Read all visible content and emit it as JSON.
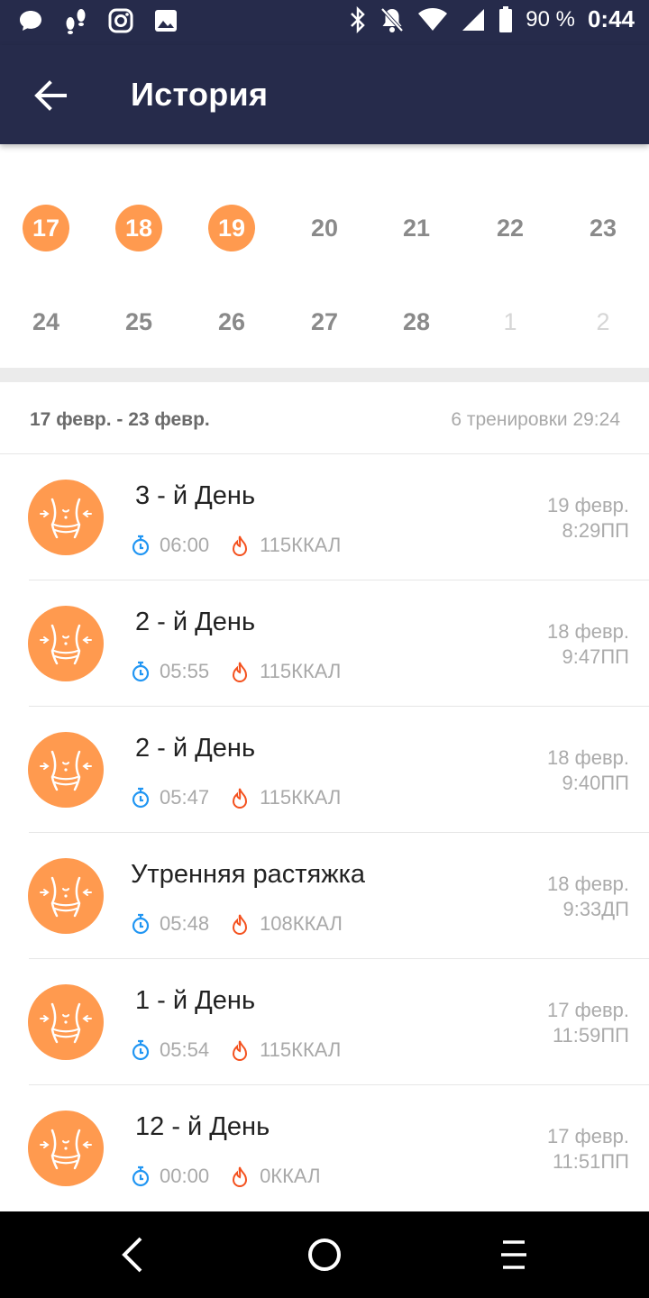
{
  "status_bar": {
    "battery": "90 %",
    "time": "0:44",
    "left_icons": [
      "chat-icon",
      "steps-icon",
      "instagram-icon",
      "image-icon"
    ],
    "right_icons": [
      "bluetooth-icon",
      "notifications-off-icon",
      "wifi-icon",
      "signal-icon",
      "battery-icon"
    ]
  },
  "app_bar": {
    "title": "История",
    "back_icon": "arrow-left-icon"
  },
  "calendar": {
    "rows": [
      {
        "days": [
          {
            "label": "17",
            "state": "done"
          },
          {
            "label": "18",
            "state": "done"
          },
          {
            "label": "19",
            "state": "done"
          },
          {
            "label": "20",
            "state": "normal"
          },
          {
            "label": "21",
            "state": "normal"
          },
          {
            "label": "22",
            "state": "normal"
          },
          {
            "label": "23",
            "state": "normal"
          }
        ]
      },
      {
        "days": [
          {
            "label": "24",
            "state": "normal"
          },
          {
            "label": "25",
            "state": "normal"
          },
          {
            "label": "26",
            "state": "normal"
          },
          {
            "label": "27",
            "state": "normal"
          },
          {
            "label": "28",
            "state": "normal"
          },
          {
            "label": "1",
            "state": "faded"
          },
          {
            "label": "2",
            "state": "faded"
          }
        ]
      }
    ]
  },
  "week": {
    "range": "17 февр. - 23 февр.",
    "summary": "6 тренировки 29:24"
  },
  "workouts": [
    {
      "title": "3 - й День",
      "duration": "06:00",
      "calories": "115ККАЛ",
      "date": "19 февр.",
      "time": "8:29ПП"
    },
    {
      "title": "2 - й День",
      "duration": "05:55",
      "calories": "115ККАЛ",
      "date": "18 февр.",
      "time": "9:47ПП"
    },
    {
      "title": "2 - й День",
      "duration": "05:47",
      "calories": "115ККАЛ",
      "date": "18 февр.",
      "time": "9:40ПП"
    },
    {
      "title": "Утренняя растяжка",
      "duration": "05:48",
      "calories": "108ККАЛ",
      "date": "18 февр.",
      "time": "9:33ДП"
    },
    {
      "title": "1 - й День",
      "duration": "05:54",
      "calories": "115ККАЛ",
      "date": "17 февр.",
      "time": "11:59ПП"
    },
    {
      "title": "12 - й День",
      "duration": "00:00",
      "calories": "0ККАЛ",
      "date": "17 февр.",
      "time": "11:51ПП"
    }
  ],
  "colors": {
    "header": "#262b4b",
    "accent": "#ff9a4f",
    "timer": "#2196f3",
    "fire": "#f4511e"
  },
  "nav_bar": {
    "icons": [
      "back-triangle-icon",
      "home-circle-icon",
      "menu-icon"
    ]
  }
}
